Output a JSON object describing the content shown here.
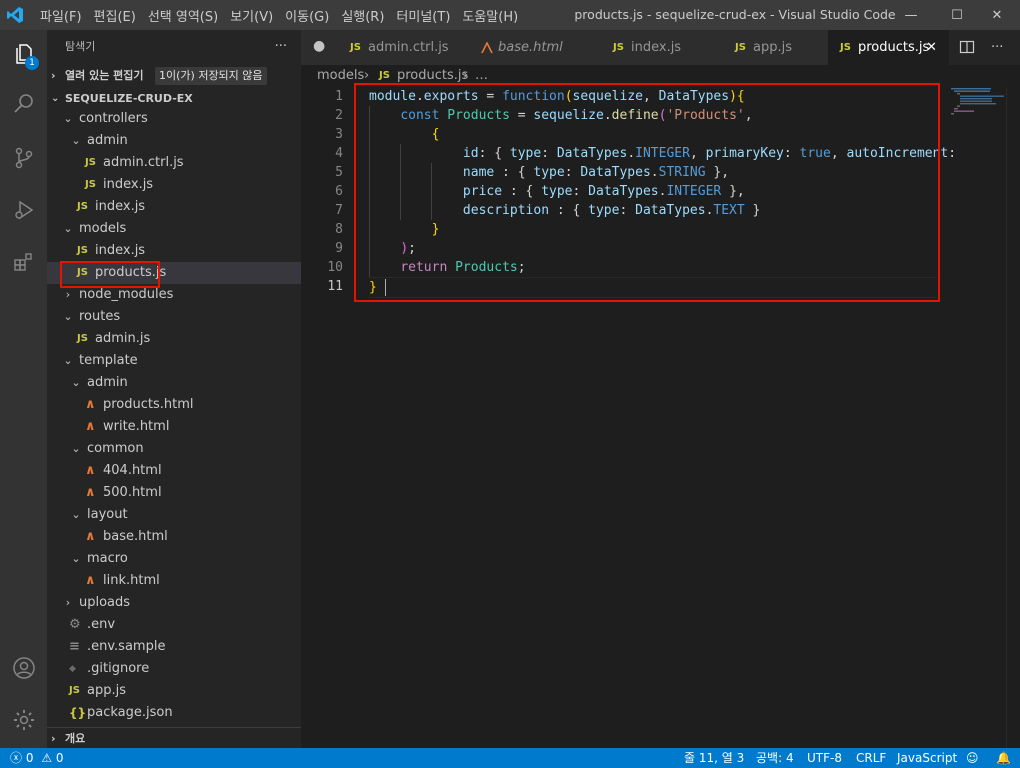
{
  "titlebar": {
    "menu": [
      "파일(F)",
      "편집(E)",
      "선택 영역(S)",
      "보기(V)",
      "이동(G)",
      "실행(R)",
      "터미널(T)",
      "도움말(H)"
    ],
    "title": "products.js - sequelize-crud-ex - Visual Studio Code",
    "minimize": "—",
    "maximize": "☐",
    "close": "✕"
  },
  "activity": {
    "explorer_badge": "1"
  },
  "sidebar": {
    "title": "탐색기",
    "more": "···",
    "open_editors": {
      "label": "열려 있는 편집기",
      "unsaved": "1이(가) 저장되지 않음"
    },
    "project": "SEQUELIZE-CRUD-EX",
    "tree": [
      {
        "label": "controllers",
        "type": "folder-open"
      },
      {
        "label": "admin",
        "type": "folder-open"
      },
      {
        "label": "admin.ctrl.js",
        "type": "js"
      },
      {
        "label": "index.js",
        "type": "js"
      },
      {
        "label": "index.js",
        "type": "js"
      },
      {
        "label": "models",
        "type": "folder-open"
      },
      {
        "label": "index.js",
        "type": "js"
      },
      {
        "label": "products.js",
        "type": "js"
      },
      {
        "label": "node_modules",
        "type": "folder"
      },
      {
        "label": "routes",
        "type": "folder-open"
      },
      {
        "label": "admin.js",
        "type": "js"
      },
      {
        "label": "template",
        "type": "folder-open"
      },
      {
        "label": "admin",
        "type": "folder-open"
      },
      {
        "label": "products.html",
        "type": "html"
      },
      {
        "label": "write.html",
        "type": "html"
      },
      {
        "label": "common",
        "type": "folder-open"
      },
      {
        "label": "404.html",
        "type": "html"
      },
      {
        "label": "500.html",
        "type": "html"
      },
      {
        "label": "layout",
        "type": "folder-open"
      },
      {
        "label": "base.html",
        "type": "html"
      },
      {
        "label": "macro",
        "type": "folder-open"
      },
      {
        "label": "link.html",
        "type": "html"
      },
      {
        "label": "uploads",
        "type": "folder"
      },
      {
        "label": ".env",
        "type": "gear"
      },
      {
        "label": ".env.sample",
        "type": "lines"
      },
      {
        "label": ".gitignore",
        "type": "diamond"
      },
      {
        "label": "app.js",
        "type": "js"
      },
      {
        "label": "package.json",
        "type": "json"
      }
    ],
    "outline": "개요"
  },
  "tabs": [
    {
      "label": "admin.ctrl.js",
      "icon": "JS"
    },
    {
      "label": "base.html",
      "icon": "html"
    },
    {
      "label": "index.js",
      "icon": "JS"
    },
    {
      "label": "app.js",
      "icon": "JS"
    },
    {
      "label": "products.js",
      "icon": "JS"
    }
  ],
  "breadcrumb": {
    "folder": "models",
    "sep": "›",
    "file": "products.js",
    "tail": "…"
  },
  "line_numbers": [
    "1",
    "2",
    "3",
    "4",
    "5",
    "6",
    "7",
    "8",
    "9",
    "10",
    "11"
  ],
  "status": {
    "errors": "0",
    "warnings": "0",
    "position": "줄 11, 열 3",
    "spaces": "공백: 4",
    "encoding": "UTF-8",
    "eol": "CRLF",
    "language": "JavaScript"
  },
  "colors": {
    "accent": "#007acc",
    "highlight_box": "#e51400",
    "js_icon": "#cbcb41",
    "html_icon": "#e37933"
  }
}
